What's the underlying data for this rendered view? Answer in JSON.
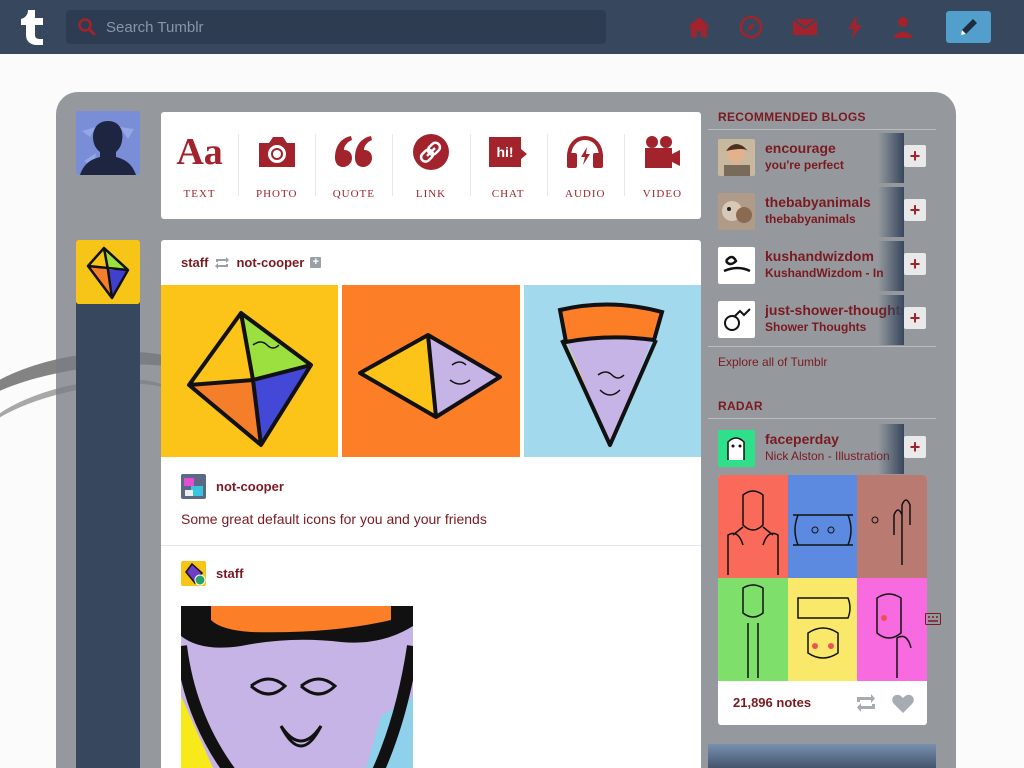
{
  "search": {
    "placeholder": "Search Tumblr"
  },
  "nav": {
    "icons": [
      "home-icon",
      "explore-icon",
      "inbox-icon",
      "activity-icon",
      "account-icon",
      "compose-icon"
    ]
  },
  "post_types": [
    {
      "label": "TEXT",
      "glyph": "Aa",
      "icon": "text-icon"
    },
    {
      "label": "PHOTO",
      "icon": "camera-icon"
    },
    {
      "label": "QUOTE",
      "glyph": "“",
      "icon": "quote-icon"
    },
    {
      "label": "LINK",
      "icon": "link-icon"
    },
    {
      "label": "CHAT",
      "glyph": "hi!",
      "icon": "chat-icon"
    },
    {
      "label": "AUDIO",
      "icon": "headphones-icon"
    },
    {
      "label": "VIDEO",
      "icon": "video-camera-icon"
    }
  ],
  "post": {
    "reblogger": "staff",
    "source": "not-cooper",
    "reblog_author": "not-cooper",
    "caption": "Some great default icons for you and your friends",
    "second_author": "staff"
  },
  "sidebar": {
    "recommended_title": "RECOMMENDED BLOGS",
    "recommended": [
      {
        "name": "encourage",
        "subtitle": "you're perfect"
      },
      {
        "name": "thebabyanimals",
        "subtitle": "thebabyanimals"
      },
      {
        "name": "kushandwizdom",
        "subtitle": "KushandWizdom - In"
      },
      {
        "name": "just-shower-thoughts",
        "subtitle": "Shower Thoughts"
      }
    ],
    "explore_link": "Explore all of Tumblr",
    "radar_title": "RADAR",
    "radar": {
      "name": "faceperday",
      "subtitle": "Nick Alston - Illustration",
      "notes": "21,896 notes"
    }
  },
  "colors": {
    "nav_bg": "#37475d",
    "accent": "#a2232c",
    "text_link": "#7a1a20",
    "compose_bg": "#529ecc"
  }
}
